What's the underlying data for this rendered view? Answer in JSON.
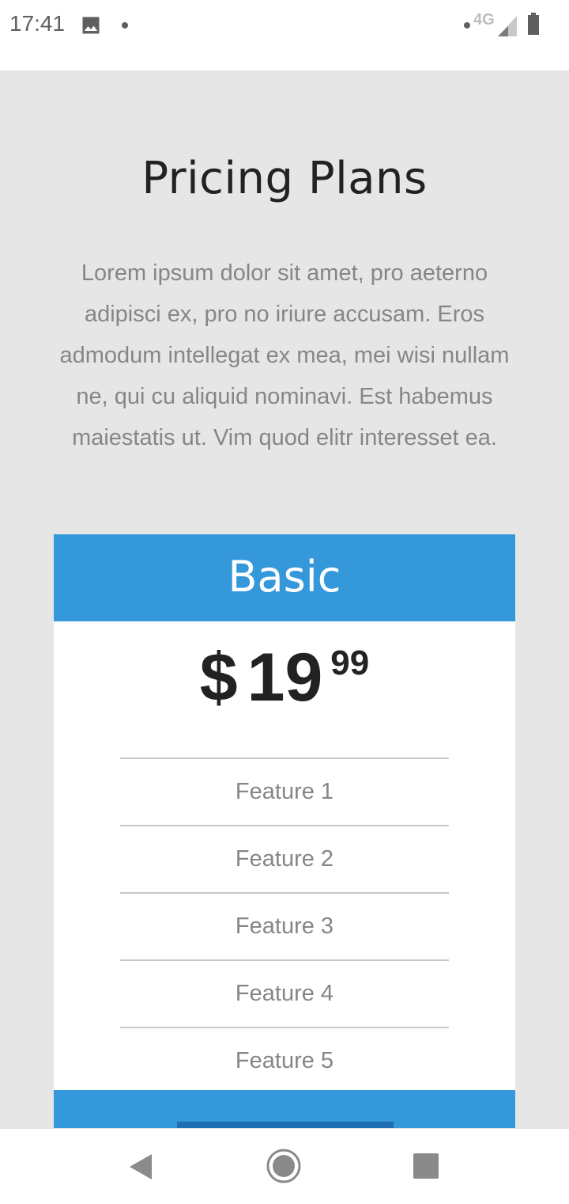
{
  "status_bar": {
    "time": "17:41",
    "network": "4G",
    "icons": [
      "image-icon",
      "notification-dot-icon",
      "signal-icon",
      "battery-icon"
    ]
  },
  "page": {
    "title": "Pricing Plans",
    "intro": "Lorem ipsum dolor sit amet, pro aeterno adipisci ex, pro no iriure accusam. Eros admodum intellegat ex mea, mei wisi nullam ne, qui cu aliquid nominavi. Est habemus maiestatis ut. Vim quod elitr interesset ea."
  },
  "plan": {
    "name": "Basic",
    "currency": "$",
    "price_whole": "19",
    "price_cents": "99",
    "features": [
      "Feature 1",
      "Feature 2",
      "Feature 3",
      "Feature 4",
      "Feature 5"
    ]
  },
  "colors": {
    "accent": "#3498db",
    "button": "#1f6fb2",
    "background": "#e6e6e6"
  },
  "nav_bar": {
    "icons": [
      "back-icon",
      "home-icon",
      "recents-icon"
    ]
  }
}
